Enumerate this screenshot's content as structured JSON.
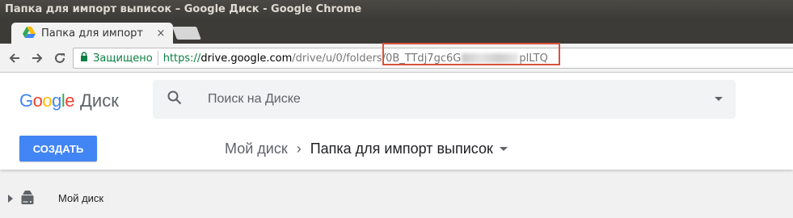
{
  "window": {
    "title": "Папка для импорт выписок – Google Диск - Google Chrome"
  },
  "tab": {
    "title": "Папка для импорт",
    "close": "×"
  },
  "address_bar": {
    "secure_label": "Защищено",
    "url_scheme": "https://",
    "url_host": "drive.google.com",
    "url_path": "/drive/u/0/folders/",
    "url_id_start": "0B_TTdj7gc6G",
    "url_id_end": "plLTQ"
  },
  "drive": {
    "logo_parts": [
      "G",
      "o",
      "o",
      "g",
      "l",
      "e"
    ],
    "product_name": "Диск",
    "brand_colors": [
      "#4285f4",
      "#ea4335",
      "#fbbc05",
      "#4285f4",
      "#34a853",
      "#ea4335"
    ],
    "search_placeholder": "Поиск на Диске",
    "create_button": "СОЗДАТЬ",
    "accent": "#4285f4"
  },
  "breadcrumb": {
    "root": "Мой диск",
    "separator": "›",
    "current": "Папка для импорт выписок"
  },
  "sidebar": {
    "items": [
      {
        "label": "Мой диск",
        "icon": "drive-icon"
      }
    ]
  }
}
